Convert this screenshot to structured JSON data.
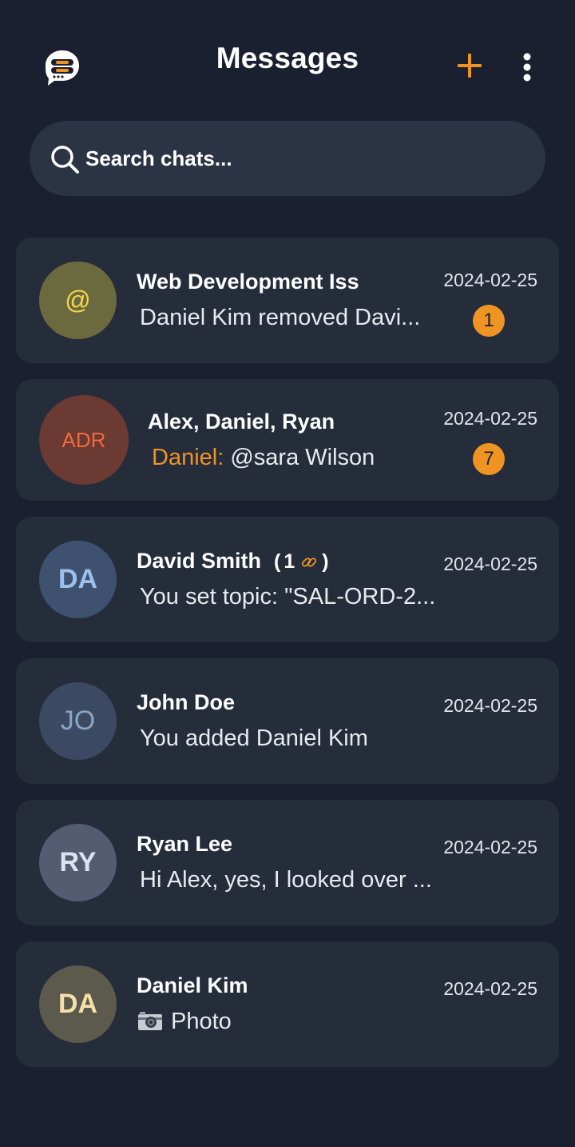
{
  "header": {
    "title": "Messages",
    "logo_icon": "chat-bubble-logo-icon",
    "add_icon": "plus-icon",
    "more_icon": "more-vertical-icon",
    "accent_color": "#ef9423"
  },
  "search": {
    "placeholder": "Search chats...",
    "icon": "search-icon"
  },
  "chats": [
    {
      "name": "Web Development Iss",
      "preview": "Daniel Kim removed Davi...",
      "time": "2024-02-25",
      "unread": "1",
      "avatar_text": "@",
      "avatar_bg": "#6b6a3f",
      "avatar_fg": "#f2d64a"
    },
    {
      "name": "Alex, Daniel, Ryan",
      "sender": "Daniel:",
      "preview": " @sara Wilson",
      "time": "2024-02-25",
      "unread": "7",
      "avatar_text": "ADR",
      "avatar_bg": "#6b3a33",
      "avatar_fg": "#f06a3a"
    },
    {
      "name": "David Smith",
      "link_count": "1",
      "link_icon": "link-icon",
      "preview": "You set topic: \"SAL-ORD-2...",
      "time": "2024-02-25",
      "avatar_text": "DA",
      "avatar_bg": "#3e5270",
      "avatar_fg": "#9cc0ec"
    },
    {
      "name": "John Doe",
      "preview": "You added Daniel Kim",
      "time": "2024-02-25",
      "avatar_text": "JO",
      "avatar_bg": "#3b4a62",
      "avatar_fg": "#8aa4c6"
    },
    {
      "name": "Ryan Lee",
      "preview": "Hi Alex, yes, I looked over ...",
      "time": "2024-02-25",
      "avatar_text": "RY",
      "avatar_bg": "#545c72",
      "avatar_fg": "#dde3f0"
    },
    {
      "name": "Daniel Kim",
      "preview": "Photo",
      "preview_icon": "camera-icon",
      "time": "2024-02-25",
      "avatar_text": "DA",
      "avatar_bg": "#5c5a4c",
      "avatar_fg": "#f5e0a8"
    }
  ]
}
